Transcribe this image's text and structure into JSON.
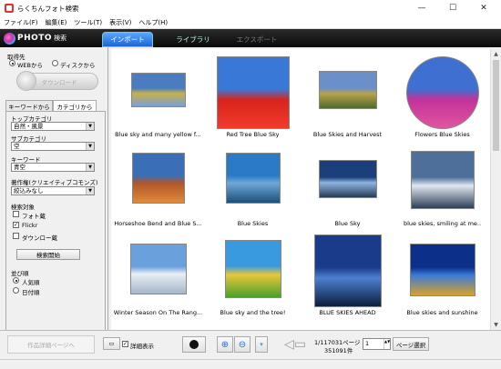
{
  "window": {
    "title": "らくちんフォト検索"
  },
  "menu": [
    "ファイル(F)",
    "編集(E)",
    "ツール(T)",
    "表示(V)",
    "ヘルプ(H)"
  ],
  "header": {
    "logo_text": "PHOTO",
    "logo_sub": "検索",
    "tabs": [
      "インポート",
      "ライブラリ",
      "エクスポート"
    ]
  },
  "sidebar": {
    "source_label": "取得先",
    "source_web": "WEBから",
    "source_disk": "ディスクから",
    "download_label": "ダウンロード",
    "subtabs": [
      "キーワードから",
      "カテゴリから"
    ],
    "top_category_label": "トップカテゴリ",
    "top_category_value": "自然・風景",
    "sub_category_label": "サブカテゴリ",
    "sub_category_value": "空",
    "keyword_label": "キーワード",
    "keyword_value": "青空",
    "copyright_label": "著作権(クリエイティブコモンズ)",
    "copyright_value": "絞込みなし",
    "target_label": "検索対象",
    "targets": [
      {
        "label": "フォト蔵",
        "checked": false
      },
      {
        "label": "Flickr",
        "checked": true
      },
      {
        "label": "ダウンロー蔵",
        "checked": false
      }
    ],
    "search_button": "検索開始",
    "sort_label": "並び順",
    "sort_options": [
      {
        "label": "人気順",
        "selected": true
      },
      {
        "label": "日付順",
        "selected": false
      }
    ]
  },
  "photos": [
    {
      "caption": "Blue sky and many yellow f...",
      "palette": [
        "#4a7dc0",
        "#c7b04a",
        "#7aa0d8"
      ]
    },
    {
      "caption": "Red Tree Blue Sky",
      "palette": [
        "#3a78d8",
        "#d8241c",
        "#f03a2a"
      ]
    },
    {
      "caption": "Blue Skies and Harvest",
      "palette": [
        "#6b8fc9",
        "#b9a24a",
        "#4f6a2e"
      ]
    },
    {
      "caption": "Flowers Blue Skies",
      "palette": [
        "#3f6fd0",
        "#c4329a",
        "#e0559f"
      ]
    },
    {
      "caption": "Horseshoe Bend and Blue S...",
      "palette": [
        "#3a6fb8",
        "#b0562a",
        "#e08a3a"
      ]
    },
    {
      "caption": "Blue Skies",
      "palette": [
        "#2a7ac8",
        "#6fa8d8",
        "#1d4f7a"
      ]
    },
    {
      "caption": "Blue Sky",
      "palette": [
        "#1b3f7a",
        "#8fb6e0",
        "#263a55"
      ]
    },
    {
      "caption": "blue skies, smiling at me..",
      "palette": [
        "#4d6f9a",
        "#dfe6ee",
        "#2d3f57"
      ]
    },
    {
      "caption": "Winter Season On The Rang...",
      "palette": [
        "#6aa0dc",
        "#e8eef4",
        "#a5b6c8"
      ]
    },
    {
      "caption": "Blue sky and the tree!",
      "palette": [
        "#3a9ae0",
        "#e8c73a",
        "#4aa02a"
      ]
    },
    {
      "caption": "BLUE SKIES AHEAD",
      "palette": [
        "#1a3a8a",
        "#4d7fd0",
        "#0c1e3f"
      ]
    },
    {
      "caption": "Blue skies and sunshine",
      "palette": [
        "#0c2f8a",
        "#3a7ad8",
        "#d8a22a"
      ]
    }
  ],
  "bottom": {
    "detail_btn": "作品詳細ページへ",
    "detail_view": "詳細表示",
    "page_info": "1/117031ページ",
    "count_info": "351091件",
    "page_value": "1",
    "page_select": "ページ選択"
  }
}
